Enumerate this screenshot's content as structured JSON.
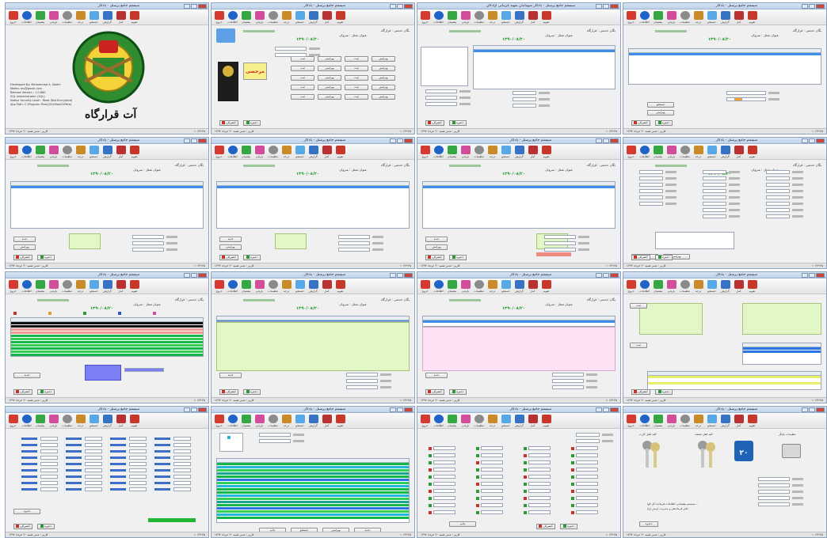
{
  "app": {
    "title": "سیستم جامع پرسنل - یادگار سومانیان شهید غریبانی آزادگان",
    "title_short": "سیستم جامع پرسنل - یادگار",
    "window_count": 16
  },
  "toolbar": {
    "items": [
      {
        "label": "خروج",
        "icon": "close-x-icon"
      },
      {
        "label": "اطلاعات",
        "icon": "info-icon"
      },
      {
        "label": "پشتیبان",
        "icon": "backup-icon"
      },
      {
        "label": "بازیابی",
        "icon": "restore-icon"
      },
      {
        "label": "تنظیمات",
        "icon": "gear-icon"
      },
      {
        "label": "درجه",
        "icon": "badge-icon"
      },
      {
        "label": "جستجو",
        "icon": "search-key-icon"
      },
      {
        "label": "گزارش",
        "icon": "report-icon"
      },
      {
        "label": "آمار",
        "icon": "stats-icon"
      },
      {
        "label": "تقویم",
        "icon": "calendar-icon"
      }
    ]
  },
  "header": {
    "unit_label": "یگان خدمتی : قرارگاه",
    "name_label": "شماره پرسنلی",
    "rank_label": "عنوان شغل : سروان",
    "date_green": "۱۳۹۰/۰۸/۲۰"
  },
  "status": {
    "left": "کاربر : مدیر    شنبه ۲۰ خرداد ۱۳۹۲",
    "right": "۱۰:۲۳:۴۵"
  },
  "buttons": {
    "save": "ذخیره",
    "cancel": "انصراف",
    "add": "ثبت",
    "edit": "ویرایش",
    "delete": "حذف",
    "new": "جدید",
    "print": "چاپ",
    "search": "جستجو"
  },
  "splash": {
    "caption": "آت قرارگاه",
    "info_lines": [
      "Developed By: Mohammad A. Salehi",
      "Mailto: ms@gmail.com",
      "Release Version : 1.0.860",
      "SQL Administrator: (SQL)",
      "Native Security Level : Read (Not Encrypted)",
      "App Path: C:\\Program Files\\(SQLMainOrPath)"
    ]
  },
  "lock_window": {
    "printer_label": "تنظیمات چاپگر",
    "keys_left": "کلید قفل صفحه",
    "keys_right": "کلید قفل کارت",
    "calendar_day": "۲۰",
    "notes": [
      "سیستم پشتیبانی اطلاعات فرمانده کل قوا...",
      "دفتر فرماندهی و مدیریت ارتش (ح)"
    ]
  },
  "photo": {
    "stamp_text": "مرخصی"
  },
  "colors": {
    "title_bg": "#c9dbf0",
    "selected_row": "#3d8ee8",
    "green_panel": "#e2f7c6",
    "pink_panel": "#fde2f6",
    "blue_panel": "#7c7ef3",
    "status_green": "#22b52f"
  }
}
